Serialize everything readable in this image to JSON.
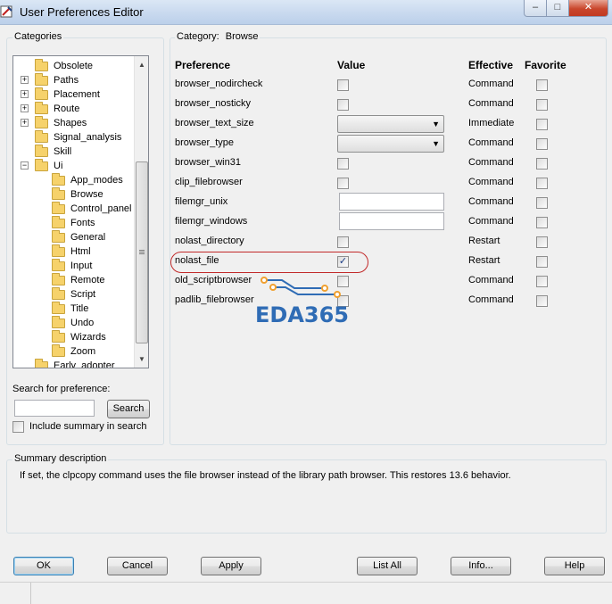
{
  "window": {
    "title": "User Preferences Editor",
    "controls": {
      "minimize": "–",
      "maximize": "□",
      "close": "✕"
    }
  },
  "categories": {
    "label": "Categories",
    "items": [
      {
        "label": "Obsolete",
        "expander": ""
      },
      {
        "label": "Paths",
        "expander": "+"
      },
      {
        "label": "Placement",
        "expander": "+"
      },
      {
        "label": "Route",
        "expander": "+"
      },
      {
        "label": "Shapes",
        "expander": "+"
      },
      {
        "label": "Signal_analysis",
        "expander": ""
      },
      {
        "label": "Skill",
        "expander": ""
      },
      {
        "label": "Ui",
        "expander": "−"
      },
      {
        "label": "App_modes",
        "expander": ""
      },
      {
        "label": "Browse",
        "expander": ""
      },
      {
        "label": "Control_panel",
        "expander": ""
      },
      {
        "label": "Fonts",
        "expander": ""
      },
      {
        "label": "General",
        "expander": ""
      },
      {
        "label": "Html",
        "expander": ""
      },
      {
        "label": "Input",
        "expander": ""
      },
      {
        "label": "Remote",
        "expander": ""
      },
      {
        "label": "Script",
        "expander": ""
      },
      {
        "label": "Title",
        "expander": ""
      },
      {
        "label": "Undo",
        "expander": ""
      },
      {
        "label": "Wizards",
        "expander": ""
      },
      {
        "label": "Zoom",
        "expander": ""
      },
      {
        "label": "Early_adopter",
        "expander": ""
      }
    ],
    "search_label": "Search for preference:",
    "search_value": "",
    "search_button": "Search",
    "include_summary_label": "Include summary in search",
    "include_summary_checked": false
  },
  "category_panel": {
    "label_prefix": "Category:",
    "label_value": "Browse",
    "headers": {
      "preference": "Preference",
      "value": "Value",
      "effective": "Effective",
      "favorite": "Favorite"
    },
    "rows": [
      {
        "name": "browser_nodircheck",
        "type": "checkbox",
        "checked": false,
        "effective": "Command"
      },
      {
        "name": "browser_nosticky",
        "type": "checkbox",
        "checked": false,
        "effective": "Command"
      },
      {
        "name": "browser_text_size",
        "type": "combo",
        "value": "",
        "effective": "Immediate"
      },
      {
        "name": "browser_type",
        "type": "combo",
        "value": "",
        "effective": "Command"
      },
      {
        "name": "browser_win31",
        "type": "checkbox",
        "checked": false,
        "effective": "Command"
      },
      {
        "name": "clip_filebrowser",
        "type": "checkbox",
        "checked": false,
        "effective": "Command"
      },
      {
        "name": "filemgr_unix",
        "type": "text",
        "value": "",
        "effective": "Command"
      },
      {
        "name": "filemgr_windows",
        "type": "text",
        "value": "",
        "effective": "Command"
      },
      {
        "name": "nolast_directory",
        "type": "checkbox",
        "checked": false,
        "effective": "Restart"
      },
      {
        "name": "nolast_file",
        "type": "checkbox",
        "checked": true,
        "effective": "Restart"
      },
      {
        "name": "old_scriptbrowser",
        "type": "checkbox",
        "checked": false,
        "effective": "Command"
      },
      {
        "name": "padlib_filebrowser",
        "type": "checkbox",
        "checked": false,
        "effective": "Command"
      }
    ]
  },
  "watermark": {
    "text": "EDA365"
  },
  "summary": {
    "label": "Summary description",
    "text": "If set, the clpcopy command uses the file browser instead of the library path browser. This restores 13.6 behavior."
  },
  "buttons": {
    "ok": "OK",
    "cancel": "Cancel",
    "apply": "Apply",
    "list_all": "List All",
    "info": "Info...",
    "help": "Help"
  },
  "colors": {
    "highlight_oval": "#c22a2a",
    "watermark": "#2f6cb5",
    "watermark_dots": "#f0a030"
  }
}
